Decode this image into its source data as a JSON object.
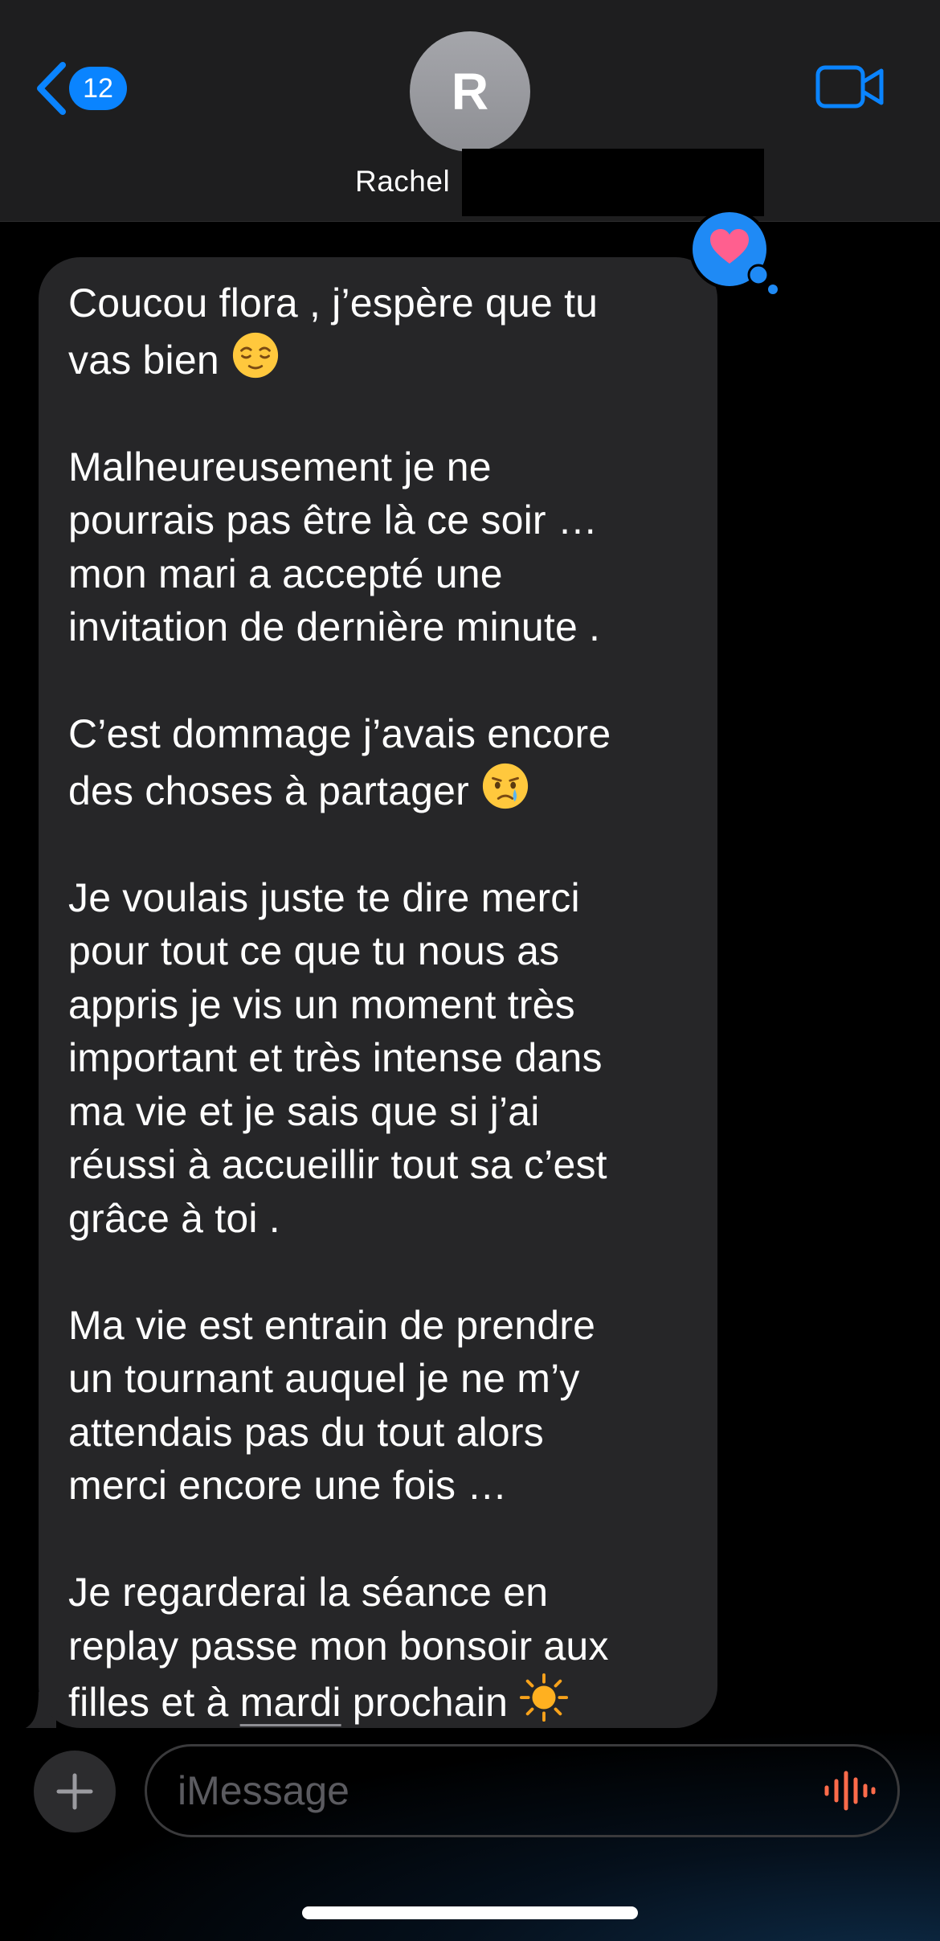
{
  "header": {
    "back_badge_count": "12",
    "avatar_initial": "R",
    "contact_name": "Rachel"
  },
  "message": {
    "paragraphs": [
      {
        "text": "Coucou flora , j’espère que tu\nvas bien ",
        "emoji": "relieved-face-emoji"
      },
      {
        "text": "Malheureusement je ne\npourrais pas être là ce soir …\nmon mari a accepté une\ninvitation de dernière minute ."
      },
      {
        "text": "C’est dommage j’avais encore\ndes choses à partager ",
        "emoji": "crying-face-emoji"
      },
      {
        "text": "Je voulais juste te dire merci\npour tout ce que tu nous as\nappris je vis un moment très\nimportant et très intense dans\nma vie et je sais que si j’ai\nréussi à accueillir tout sa c’est\ngrâce à toi ."
      },
      {
        "text": "Ma vie est entrain de prendre\nun tournant auquel je ne m’y\nattendais pas du tout alors\nmerci encore une fois …"
      }
    ],
    "last_paragraph": {
      "before": "Je regarderai la séance en\nreplay passe mon bonsoir aux\nfilles et à ",
      "link_word": "mardi",
      "after": " prochain ",
      "emoji": "sun-emoji"
    },
    "tapback": "heart-reaction-icon"
  },
  "composer": {
    "placeholder": "iMessage"
  },
  "colors": {
    "accent": "#0a84ff",
    "header_bg": "#1e1e1f",
    "bubble_bg": "#262628",
    "heart": "#ff5f8f",
    "mic": "#ff6b4a"
  }
}
